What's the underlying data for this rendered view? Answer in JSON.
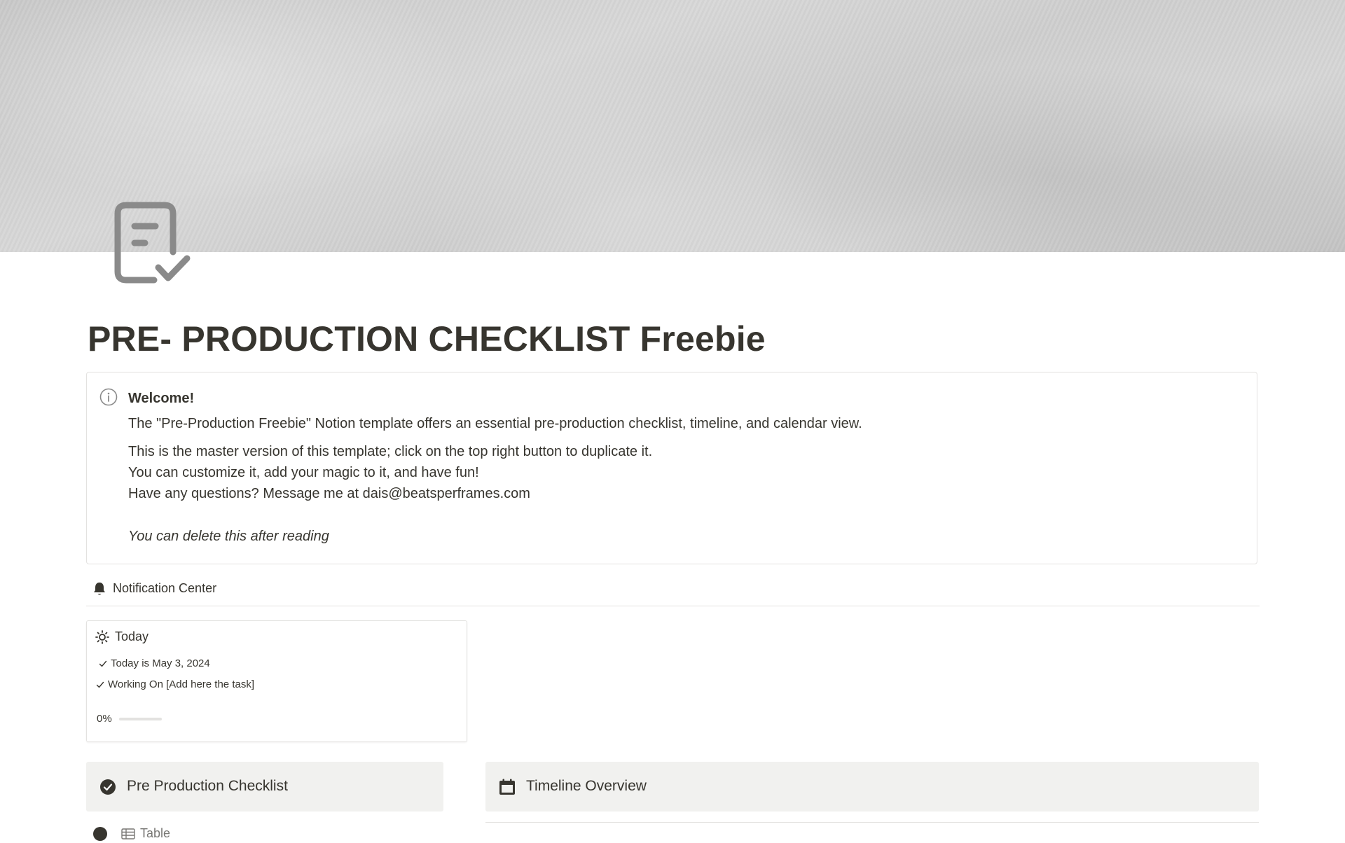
{
  "page": {
    "title": "PRE- PRODUCTION CHECKLIST Freebie",
    "cover": "grey-texture-cover",
    "icon": "checklist-icon"
  },
  "callout": {
    "icon": "info-icon",
    "heading": "Welcome!",
    "lines": [
      "The \"Pre-Production Freebie\" Notion template offers an essential pre-production checklist, timeline, and calendar view.",
      "This is the master version of this template; click on the top right button to duplicate it.",
      "You can customize it, add your magic to it, and have fun!",
      "Have any questions? Message me at dais@beatsperframes.com"
    ],
    "footer": "You can delete this after reading"
  },
  "notification_center": {
    "icon": "bell-icon",
    "label": "Notification Center"
  },
  "today": {
    "icon": "sun-icon",
    "title": "Today",
    "items": [
      "Today is May 3, 2024",
      "Working On [Add here the task]"
    ],
    "progress_label": "0%",
    "progress_fraction": 0
  },
  "sections": [
    {
      "icon": "check-circle-icon",
      "label": "Pre Production Checklist"
    },
    {
      "icon": "calendar-icon",
      "label": "Timeline Overview"
    }
  ],
  "view": {
    "icon": "table-icon",
    "label": "Table"
  },
  "colors": {
    "text": "#37352f",
    "muted": "#787774",
    "border": "#e3e2e0",
    "section_bg": "#f1f1ef"
  }
}
